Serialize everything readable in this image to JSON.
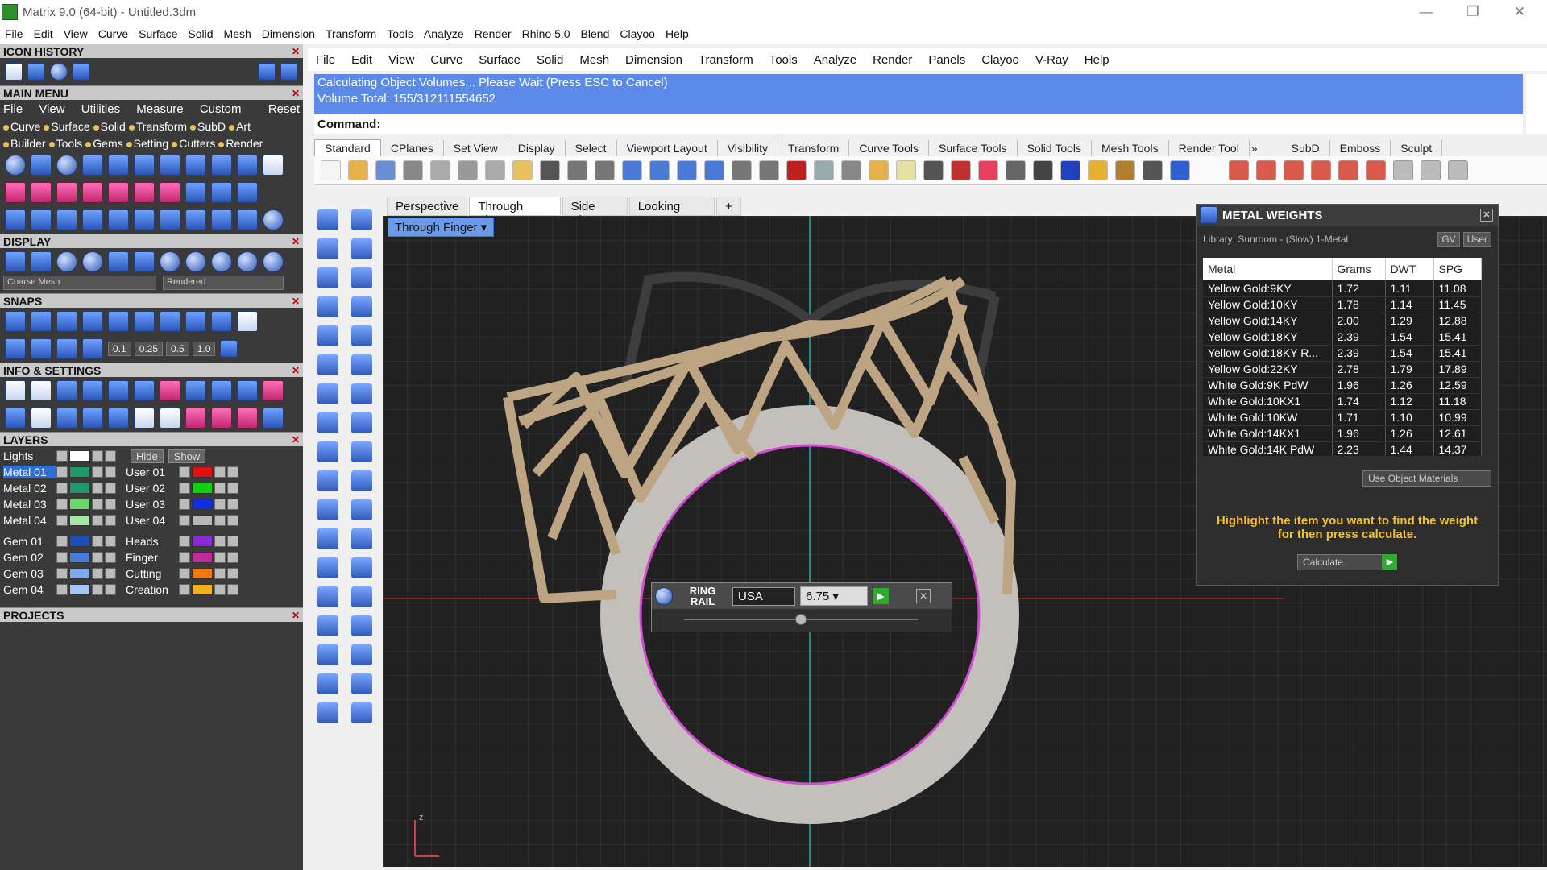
{
  "window": {
    "title": "Matrix 9.0 (64-bit) - Untitled.3dm",
    "minimize": "—",
    "restore": "❐",
    "close": "✕"
  },
  "menubar": [
    "File",
    "Edit",
    "View",
    "Curve",
    "Surface",
    "Solid",
    "Mesh",
    "Dimension",
    "Transform",
    "Tools",
    "Analyze",
    "Render",
    "Rhino 5.0",
    "Blend",
    "Clayoo",
    "Help"
  ],
  "left_panel": {
    "icon_history": "ICON HISTORY",
    "main_menu": "MAIN MENU",
    "main_menu_items": [
      "File",
      "View",
      "Utilities",
      "Measure",
      "Custom"
    ],
    "main_menu_reset": "Reset",
    "categories_row1": [
      "Curve",
      "Surface",
      "Solid",
      "Transform",
      "SubD",
      "Art"
    ],
    "categories_row2": [
      "Builder",
      "Tools",
      "Gems",
      "Setting",
      "Cutters",
      "Render"
    ],
    "display": "DISPLAY",
    "mesh_select": "Coarse Mesh",
    "render_select": "Rendered",
    "snaps": "SNAPS",
    "snap_values": [
      "0.1",
      "0.25",
      "0.5",
      "1.0"
    ],
    "info_settings": "INFO & SETTINGS",
    "layers": "LAYERS",
    "layer_lights": "Lights",
    "hide_label": "Hide",
    "show_label": "Show",
    "layers_left": [
      "Metal 01",
      "Metal 02",
      "Metal 03",
      "Metal 04",
      "Gem 01",
      "Gem 02",
      "Gem 03",
      "Gem 04"
    ],
    "layers_right": [
      "User 01",
      "User 02",
      "User 03",
      "User 04",
      "Heads",
      "Finger",
      "Cutting",
      "Creation"
    ],
    "layer_colors_left": [
      "#1e9a6a",
      "#1e9a6a",
      "#6ad86a",
      "#a8e6a8",
      "#1d4fb8",
      "#4a7bd8",
      "#7fa8ee",
      "#a8c4f4"
    ],
    "layer_colors_right": [
      "#e01010",
      "#10d010",
      "#1030e0",
      "#b8b8b8",
      "#8a2ad8",
      "#c02a9a",
      "#f07a10",
      "#f0b020"
    ],
    "projects": "PROJECTS"
  },
  "app_menubar": [
    "File",
    "Edit",
    "View",
    "Curve",
    "Surface",
    "Solid",
    "Mesh",
    "Dimension",
    "Transform",
    "Tools",
    "Analyze",
    "Render",
    "Panels",
    "Clayoo",
    "V-Ray",
    "Help"
  ],
  "command": {
    "line1": "Calculating Object Volumes... Please Wait (Press ESC to Cancel)",
    "line2": "Volume Total: 155/312111554652",
    "prompt": "Command:"
  },
  "tabs": [
    "Standard",
    "CPlanes",
    "Set View",
    "Display",
    "Select",
    "Viewport Layout",
    "Visibility",
    "Transform",
    "Curve Tools",
    "Surface Tools",
    "Solid Tools",
    "Mesh Tools",
    "Render Tool"
  ],
  "tabs_right": [
    "SubD",
    "Emboss",
    "Sculpt"
  ],
  "viewport_tabs": [
    "Perspective",
    "Through Finger",
    "Side View",
    "Looking Down"
  ],
  "viewport_name": "Through Finger",
  "ring_rail": {
    "label_top": "RING",
    "label_bottom": "RAIL",
    "region": "USA",
    "size": "6.75"
  },
  "metal_weights": {
    "title": "METAL WEIGHTS",
    "library": "Library: Sunroom - (Slow) 1-Metal",
    "gv_label": "GV",
    "user_label": "User",
    "columns": [
      "Metal",
      "Grams",
      "DWT",
      "SPG"
    ],
    "rows": [
      [
        "Yellow Gold:9KY",
        "1.72",
        "1.11",
        "11.08"
      ],
      [
        "Yellow Gold:10KY",
        "1.78",
        "1.14",
        "11.45"
      ],
      [
        "Yellow Gold:14KY",
        "2.00",
        "1.29",
        "12.88"
      ],
      [
        "Yellow Gold:18KY",
        "2.39",
        "1.54",
        "15.41"
      ],
      [
        "Yellow Gold:18KY R...",
        "2.39",
        "1.54",
        "15.41"
      ],
      [
        "Yellow Gold:22KY",
        "2.78",
        "1.79",
        "17.89"
      ],
      [
        "White Gold:9K PdW",
        "1.96",
        "1.26",
        "12.59"
      ],
      [
        "White Gold:10KX1",
        "1.74",
        "1.12",
        "11.18"
      ],
      [
        "White Gold:10KW",
        "1.71",
        "1.10",
        "10.99"
      ],
      [
        "White Gold:14KX1",
        "1.96",
        "1.26",
        "12.61"
      ],
      [
        "White Gold:14K PdW",
        "2.23",
        "1.44",
        "14.37"
      ]
    ],
    "use_object_materials": "Use Object Materials",
    "note": "Highlight the item you want to find the weight for then press calculate.",
    "calculate": "Calculate"
  }
}
